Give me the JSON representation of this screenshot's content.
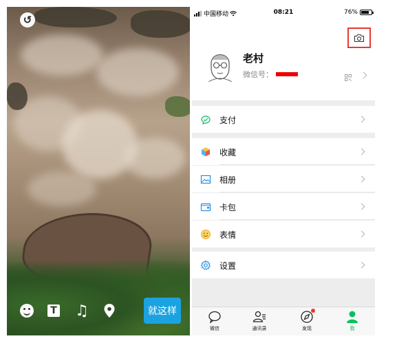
{
  "editor": {
    "back_icon": "undo-arrow-icon",
    "tools": [
      {
        "name": "emoji",
        "icon": "smiley-icon"
      },
      {
        "name": "text",
        "icon": "text-T-icon",
        "glyph": "T"
      },
      {
        "name": "music",
        "icon": "music-note-icon",
        "glyph": "♫"
      },
      {
        "name": "location",
        "icon": "location-pin-icon"
      }
    ],
    "done_label": "就这样",
    "done_color": "#1aa3e0"
  },
  "status_bar": {
    "carrier": "中国移动",
    "time": "08:21",
    "battery": "76%"
  },
  "profile": {
    "name": "老村",
    "wechat_id_label": "微信号：",
    "camera_icon": "camera-icon",
    "highlight_color": "#e53935"
  },
  "menu": {
    "pay": "支付",
    "favorites": "收藏",
    "album": "相册",
    "cards": "卡包",
    "stickers": "表情",
    "settings": "设置"
  },
  "tabbar": {
    "tabs": [
      {
        "label": "微信",
        "icon": "chat-bubble-icon"
      },
      {
        "label": "通讯录",
        "icon": "contacts-icon"
      },
      {
        "label": "发现",
        "icon": "compass-icon"
      },
      {
        "label": "我",
        "icon": "person-icon"
      }
    ],
    "active_color": "#07c160",
    "badge_color": "#f43530"
  }
}
